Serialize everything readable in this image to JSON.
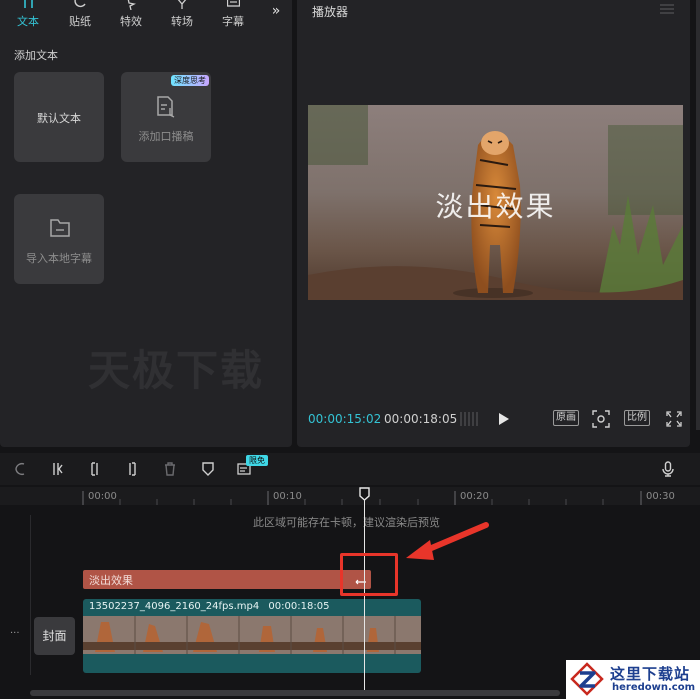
{
  "toolbar": {
    "tabs": [
      {
        "label": "文本",
        "icon": "text-icon",
        "active": true
      },
      {
        "label": "贴纸",
        "icon": "sticker-icon"
      },
      {
        "label": "特效",
        "icon": "effects-icon"
      },
      {
        "label": "转场",
        "icon": "transition-icon"
      },
      {
        "label": "字幕",
        "icon": "subtitle-icon"
      }
    ],
    "more": "»"
  },
  "text_panel": {
    "section_title": "添加文本",
    "default_text": "默认文本",
    "add_voiceover": "添加口播稿",
    "deep_think_badge": "深度思考",
    "import_subtitles": "导入本地字幕"
  },
  "watermark": "天极下载",
  "player": {
    "title": "播放器",
    "overlay_text": "淡出效果",
    "current_time": "00:00:15:02",
    "total_time": "00:00:18:05",
    "original_btn": "原画",
    "ratio_btn": "比例"
  },
  "timeline": {
    "limited_badge": "限免",
    "ticks": [
      "00:00",
      "00:10",
      "00:20",
      "00:30"
    ],
    "hint": "此区域可能存在卡顿，建议渲染后预览",
    "text_clip": "淡出效果",
    "video_clip_name": "13502237_4096_2160_24fps.mp4",
    "video_clip_duration": "00:00:18:05",
    "cover_label": "封面",
    "more": "···"
  },
  "logo": {
    "cn": "这里下载站",
    "en": "heredown.com"
  },
  "colors": {
    "accent": "#34c3d4",
    "text_clip": "#b05446",
    "video_clip": "#1b5a5e",
    "highlight": "#e8352a"
  }
}
